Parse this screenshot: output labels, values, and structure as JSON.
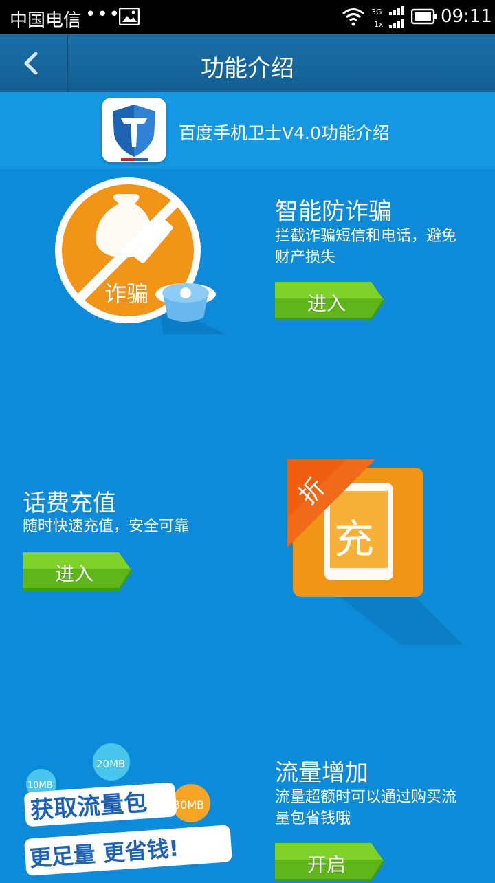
{
  "status_bar": {
    "carrier": "中国电信",
    "dots": "•••",
    "network_top": "3G",
    "network_bottom": "1x",
    "time": "09:11"
  },
  "nav": {
    "title": "功能介绍"
  },
  "header": {
    "text": "百度手机卫士V4.0功能介绍"
  },
  "features": [
    {
      "title": "智能防诈骗",
      "desc_line1": "拦截诈骗短信和电话，避免",
      "desc_line2": "财产损失",
      "button": "进入",
      "art_label": "诈骗"
    },
    {
      "title": "话费充值",
      "desc_line1": "随时快速充值，安全可靠",
      "button": "进入",
      "art_corner": "折",
      "art_label": "充"
    },
    {
      "title": "流量增加",
      "desc_line1": "流量超额时可以通过购买流",
      "desc_line2": "量包省钱哦",
      "button": "开启",
      "art_line1": "获取流量包",
      "art_line2": "更足量 更省钱!",
      "badges": [
        "10MB",
        "20MB",
        "30MB"
      ]
    }
  ],
  "colors": {
    "background": "#0d8ad8",
    "navbar": "#16679c",
    "button_green": "#6cc21c",
    "art_orange": "#f29418"
  }
}
